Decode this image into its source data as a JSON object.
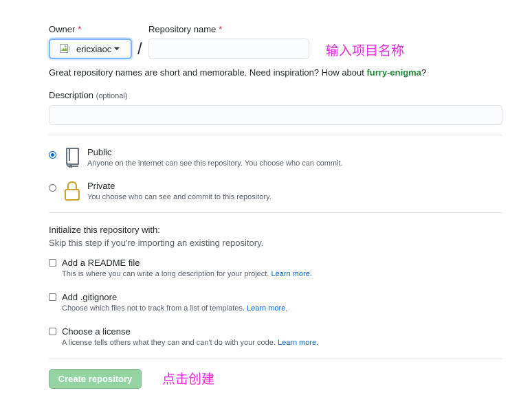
{
  "owner": {
    "label": "Owner",
    "required_mark": "*",
    "username": "ericxiaoc"
  },
  "repo": {
    "label": "Repository name",
    "required_mark": "*",
    "value": ""
  },
  "slash": "/",
  "annotations": {
    "name_hint": "输入项目名称",
    "create_hint": "点击创建"
  },
  "hint": {
    "text": "Great repository names are short and memorable. Need inspiration? How about ",
    "suggestion": "furry-enigma",
    "suffix": "?"
  },
  "description": {
    "label": "Description",
    "optional": "(optional)",
    "value": ""
  },
  "visibility": {
    "selected": "public",
    "options": [
      {
        "title": "Public",
        "note": "Anyone on the internet can see this repository. You choose who can commit.",
        "icon": "repo-book-icon"
      },
      {
        "title": "Private",
        "note": "You choose who can see and commit to this repository.",
        "icon": "lock-icon"
      }
    ]
  },
  "init": {
    "heading": "Initialize this repository with:",
    "subheading": "Skip this step if you're importing an existing repository.",
    "options": [
      {
        "title": "Add a README file",
        "note": "This is where you can write a long description for your project.",
        "link": "Learn more.",
        "checked": false
      },
      {
        "title": "Add .gitignore",
        "note": "Choose which files not to track from a list of templates.",
        "link": "Learn more.",
        "checked": false
      },
      {
        "title": "Choose a license",
        "note": "A license tells others what they can and can't do with your code.",
        "link": "Learn more.",
        "checked": false
      }
    ]
  },
  "submit": {
    "label": "Create repository",
    "enabled": false
  },
  "colors": {
    "accent": "#0366d6",
    "suggestion": "#22863a",
    "button_disabled": "#94d3a2",
    "annotation": "#e62ce0"
  }
}
